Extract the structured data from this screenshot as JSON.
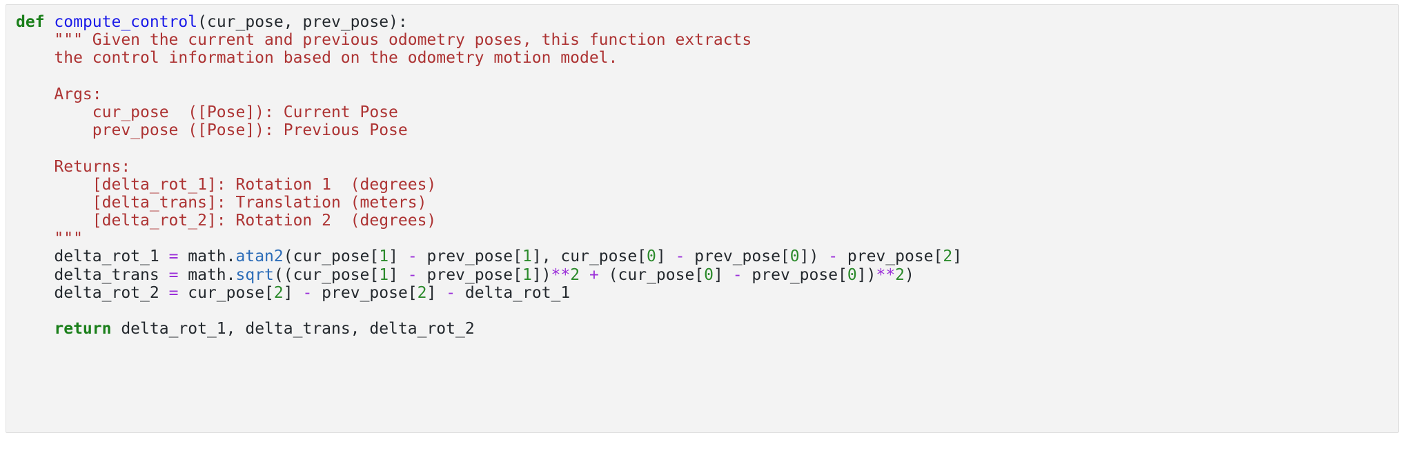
{
  "code_block": {
    "language": "python",
    "background_color": "#f3f3f3",
    "border_color": "#e0e0e0",
    "colors": {
      "keyword": "#1a7f1a",
      "function_name": "#1a1ae8",
      "builtin": "#2b6cb8",
      "string": "#ad3333",
      "number": "#2b8a2b",
      "operator": "#9b30d9",
      "text": "#24292e"
    },
    "plain_text": "def compute_control(cur_pose, prev_pose):\n    \"\"\" Given the current and previous odometry poses, this function extracts\n    the control information based on the odometry motion model.\n\n    Args:\n        cur_pose  ([Pose]): Current Pose\n        prev_pose ([Pose]): Previous Pose\n\n    Returns:\n        [delta_rot_1]: Rotation 1  (degrees)\n        [delta_trans]: Translation (meters)\n        [delta_rot_2]: Rotation 2  (degrees)\n    \"\"\"\n    delta_rot_1 = math.atan2(cur_pose[1] - prev_pose[1], cur_pose[0] - prev_pose[0]) - prev_pose[2]\n    delta_trans = math.sqrt((cur_pose[1] - prev_pose[1])**2 + (cur_pose[0] - prev_pose[0])**2)\n    delta_rot_2 = cur_pose[2] - prev_pose[2] - delta_rot_1\n\n    return delta_rot_1, delta_trans, delta_rot_2",
    "lines": [
      {
        "n": 1,
        "tokens": [
          {
            "t": "def",
            "c": "keyword"
          },
          {
            "t": " ",
            "c": "text"
          },
          {
            "t": "compute_control",
            "c": "function_name"
          },
          {
            "t": "(cur_pose, prev_pose):",
            "c": "text"
          }
        ]
      },
      {
        "n": 2,
        "tokens": [
          {
            "t": "    \"\"\" Given the current and previous odometry poses, this function extracts",
            "c": "string"
          }
        ]
      },
      {
        "n": 3,
        "tokens": [
          {
            "t": "    the control information based on the odometry motion model.",
            "c": "string"
          }
        ]
      },
      {
        "n": 4,
        "tokens": [
          {
            "t": "",
            "c": "text"
          }
        ]
      },
      {
        "n": 5,
        "tokens": [
          {
            "t": "    Args:",
            "c": "string"
          }
        ]
      },
      {
        "n": 6,
        "tokens": [
          {
            "t": "        cur_pose  ([Pose]): Current Pose",
            "c": "string"
          }
        ]
      },
      {
        "n": 7,
        "tokens": [
          {
            "t": "        prev_pose ([Pose]): Previous Pose",
            "c": "string"
          }
        ]
      },
      {
        "n": 8,
        "tokens": [
          {
            "t": "",
            "c": "text"
          }
        ]
      },
      {
        "n": 9,
        "tokens": [
          {
            "t": "    Returns:",
            "c": "string"
          }
        ]
      },
      {
        "n": 10,
        "tokens": [
          {
            "t": "        [delta_rot_1]: Rotation 1  (degrees)",
            "c": "string"
          }
        ]
      },
      {
        "n": 11,
        "tokens": [
          {
            "t": "        [delta_trans]: Translation (meters)",
            "c": "string"
          }
        ]
      },
      {
        "n": 12,
        "tokens": [
          {
            "t": "        [delta_rot_2]: Rotation 2  (degrees)",
            "c": "string"
          }
        ]
      },
      {
        "n": 13,
        "tokens": [
          {
            "t": "    \"\"\"",
            "c": "string"
          }
        ]
      },
      {
        "n": 14,
        "tokens": [
          {
            "t": "    delta_rot_1 ",
            "c": "text"
          },
          {
            "t": "=",
            "c": "operator"
          },
          {
            "t": " math.",
            "c": "text"
          },
          {
            "t": "atan2",
            "c": "builtin"
          },
          {
            "t": "(cur_pose[",
            "c": "text"
          },
          {
            "t": "1",
            "c": "number"
          },
          {
            "t": "] ",
            "c": "text"
          },
          {
            "t": "-",
            "c": "operator"
          },
          {
            "t": " prev_pose[",
            "c": "text"
          },
          {
            "t": "1",
            "c": "number"
          },
          {
            "t": "], cur_pose[",
            "c": "text"
          },
          {
            "t": "0",
            "c": "number"
          },
          {
            "t": "] ",
            "c": "text"
          },
          {
            "t": "-",
            "c": "operator"
          },
          {
            "t": " prev_pose[",
            "c": "text"
          },
          {
            "t": "0",
            "c": "number"
          },
          {
            "t": "]) ",
            "c": "text"
          },
          {
            "t": "-",
            "c": "operator"
          },
          {
            "t": " prev_pose[",
            "c": "text"
          },
          {
            "t": "2",
            "c": "number"
          },
          {
            "t": "]",
            "c": "text"
          }
        ]
      },
      {
        "n": 15,
        "tokens": [
          {
            "t": "    delta_trans ",
            "c": "text"
          },
          {
            "t": "=",
            "c": "operator"
          },
          {
            "t": " math.",
            "c": "text"
          },
          {
            "t": "sqrt",
            "c": "builtin"
          },
          {
            "t": "((cur_pose[",
            "c": "text"
          },
          {
            "t": "1",
            "c": "number"
          },
          {
            "t": "] ",
            "c": "text"
          },
          {
            "t": "-",
            "c": "operator"
          },
          {
            "t": " prev_pose[",
            "c": "text"
          },
          {
            "t": "1",
            "c": "number"
          },
          {
            "t": "])",
            "c": "text"
          },
          {
            "t": "**",
            "c": "operator"
          },
          {
            "t": "2",
            "c": "number"
          },
          {
            "t": " ",
            "c": "text"
          },
          {
            "t": "+",
            "c": "operator"
          },
          {
            "t": " (cur_pose[",
            "c": "text"
          },
          {
            "t": "0",
            "c": "number"
          },
          {
            "t": "] ",
            "c": "text"
          },
          {
            "t": "-",
            "c": "operator"
          },
          {
            "t": " prev_pose[",
            "c": "text"
          },
          {
            "t": "0",
            "c": "number"
          },
          {
            "t": "])",
            "c": "text"
          },
          {
            "t": "**",
            "c": "operator"
          },
          {
            "t": "2",
            "c": "number"
          },
          {
            "t": ")",
            "c": "text"
          }
        ]
      },
      {
        "n": 16,
        "tokens": [
          {
            "t": "    delta_rot_2 ",
            "c": "text"
          },
          {
            "t": "=",
            "c": "operator"
          },
          {
            "t": " cur_pose[",
            "c": "text"
          },
          {
            "t": "2",
            "c": "number"
          },
          {
            "t": "] ",
            "c": "text"
          },
          {
            "t": "-",
            "c": "operator"
          },
          {
            "t": " prev_pose[",
            "c": "text"
          },
          {
            "t": "2",
            "c": "number"
          },
          {
            "t": "] ",
            "c": "text"
          },
          {
            "t": "-",
            "c": "operator"
          },
          {
            "t": " delta_rot_1",
            "c": "text"
          }
        ]
      },
      {
        "n": 17,
        "tokens": [
          {
            "t": "",
            "c": "text"
          }
        ]
      },
      {
        "n": 18,
        "tokens": [
          {
            "t": "    ",
            "c": "text"
          },
          {
            "t": "return",
            "c": "keyword"
          },
          {
            "t": " delta_rot_1, delta_trans, delta_rot_2",
            "c": "text"
          }
        ]
      }
    ]
  }
}
